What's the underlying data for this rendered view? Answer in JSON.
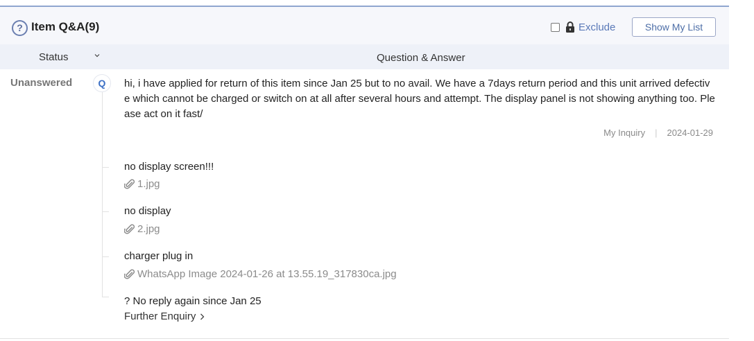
{
  "header": {
    "title": "Item Q&A(9)",
    "exclude_label": "Exclude",
    "show_my_list_label": "Show My List"
  },
  "columns": {
    "status": "Status",
    "question_answer": "Question & Answer"
  },
  "item": {
    "status": "Unanswered",
    "badge": "Q",
    "question": "hi, i have applied for return of this item since Jan 25 but to no avail. We have a 7days return period and this unit arrived defective which cannot be charged or switch on at all after several hours and attempt. The display panel is not showing anything too. Please act on it fast/",
    "meta_type": "My Inquiry",
    "meta_date": "2024-01-29",
    "replies": [
      {
        "text": "no display screen!!!",
        "attachment": "1.jpg"
      },
      {
        "text": "no display",
        "attachment": "2.jpg"
      },
      {
        "text": "charger plug in",
        "attachment": "WhatsApp Image 2024-01-26 at 13.55.19_317830ca.jpg"
      },
      {
        "text": "? No reply again since Jan 25"
      }
    ],
    "further_label": "Further Enquiry"
  },
  "colors": {
    "accent": "#5a79b8",
    "header_bg": "#f6f7fb",
    "column_bg": "#eef1f8"
  }
}
